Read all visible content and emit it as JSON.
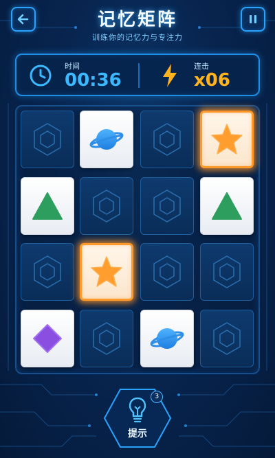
{
  "header": {
    "title": "记忆矩阵",
    "subtitle": "训练你的记忆力与专注力",
    "back_icon": "arrow-left-icon",
    "pause_icon": "pause-icon"
  },
  "stats": {
    "time_label": "时间",
    "time_value": "00:36",
    "combo_label": "连击",
    "combo_value": "x06",
    "time_color": "#3cb8ff",
    "combo_color": "#ffb21e"
  },
  "board": {
    "rows": 4,
    "cols": 4,
    "cards": [
      {
        "state": "hidden"
      },
      {
        "state": "revealed",
        "symbol": "planet"
      },
      {
        "state": "hidden"
      },
      {
        "state": "selected",
        "symbol": "star"
      },
      {
        "state": "revealed",
        "symbol": "triangle"
      },
      {
        "state": "hidden"
      },
      {
        "state": "hidden"
      },
      {
        "state": "revealed",
        "symbol": "triangle"
      },
      {
        "state": "hidden"
      },
      {
        "state": "selected",
        "symbol": "star"
      },
      {
        "state": "hidden"
      },
      {
        "state": "hidden"
      },
      {
        "state": "revealed",
        "symbol": "diamond"
      },
      {
        "state": "hidden"
      },
      {
        "state": "revealed",
        "symbol": "planet"
      },
      {
        "state": "hidden"
      }
    ]
  },
  "hint": {
    "label": "提示",
    "count": "3",
    "icon": "lightbulb-icon"
  },
  "colors": {
    "accent": "#2aa3ff",
    "selected_glow": "#ff9a2a",
    "triangle": "#2e9e5e",
    "diamond": "#8a4fe0",
    "planet": "#1e7fe0",
    "star": "#ff9d2e"
  }
}
